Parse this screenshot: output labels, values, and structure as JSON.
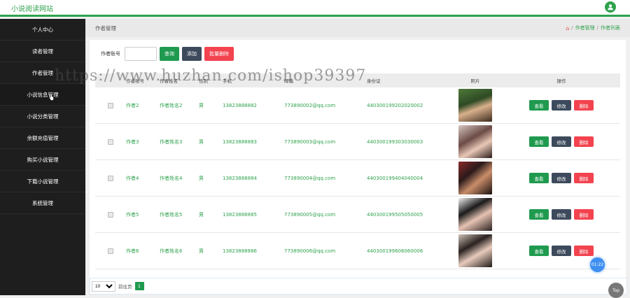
{
  "header": {
    "site_title": "小说阅读网站"
  },
  "sidebar": {
    "items": [
      {
        "label": "个人中心"
      },
      {
        "label": "读者管理"
      },
      {
        "label": "作者管理"
      },
      {
        "label": "小说信息管理"
      },
      {
        "label": "小说分类管理"
      },
      {
        "label": "余额充值管理"
      },
      {
        "label": "购买小说管理"
      },
      {
        "label": "下载小说管理"
      },
      {
        "label": "系统管理"
      }
    ]
  },
  "breadcrumb": {
    "page_title": "作者管理",
    "trail": [
      "作者管理",
      "作者列表"
    ]
  },
  "search": {
    "label": "作者账号",
    "input_value": "",
    "query_label": "查询",
    "add_label": "添加",
    "batch_delete_label": "批量删除"
  },
  "table": {
    "headers": [
      "作者账号",
      "作者姓名",
      "性别",
      "手机",
      "邮箱",
      "身份证",
      "照片",
      "操作"
    ],
    "rows": [
      {
        "account": "作者2",
        "name": "作者姓名2",
        "sex": "男",
        "phone": "13823888882",
        "email": "773890002@qq.com",
        "idcard": "440300199202020002"
      },
      {
        "account": "作者3",
        "name": "作者姓名3",
        "sex": "男",
        "phone": "13823888883",
        "email": "773890003@qq.com",
        "idcard": "440300199303030003"
      },
      {
        "account": "作者4",
        "name": "作者姓名4",
        "sex": "男",
        "phone": "13823888884",
        "email": "773890004@qq.com",
        "idcard": "440300199404040004"
      },
      {
        "account": "作者5",
        "name": "作者姓名5",
        "sex": "男",
        "phone": "13823888885",
        "email": "773890005@qq.com",
        "idcard": "440300199505050005"
      },
      {
        "account": "作者6",
        "name": "作者姓名6",
        "sex": "男",
        "phone": "13823888886",
        "email": "773890006@qq.com",
        "idcard": "440300199606060006"
      }
    ],
    "actions": {
      "view": "查看",
      "edit": "修改",
      "delete": "删除"
    }
  },
  "pager": {
    "page_size": "10",
    "goto_label": "前往页",
    "current_page": "1"
  },
  "watermark": "https://www.huzhan.com/ishop39397",
  "floating": {
    "time": "01:22",
    "top": "Top"
  },
  "colors": {
    "accent": "#2fa24d",
    "sidebar_bg": "#1e1e1e",
    "danger": "#f3434f",
    "dark_btn": "#3d4a5c"
  }
}
